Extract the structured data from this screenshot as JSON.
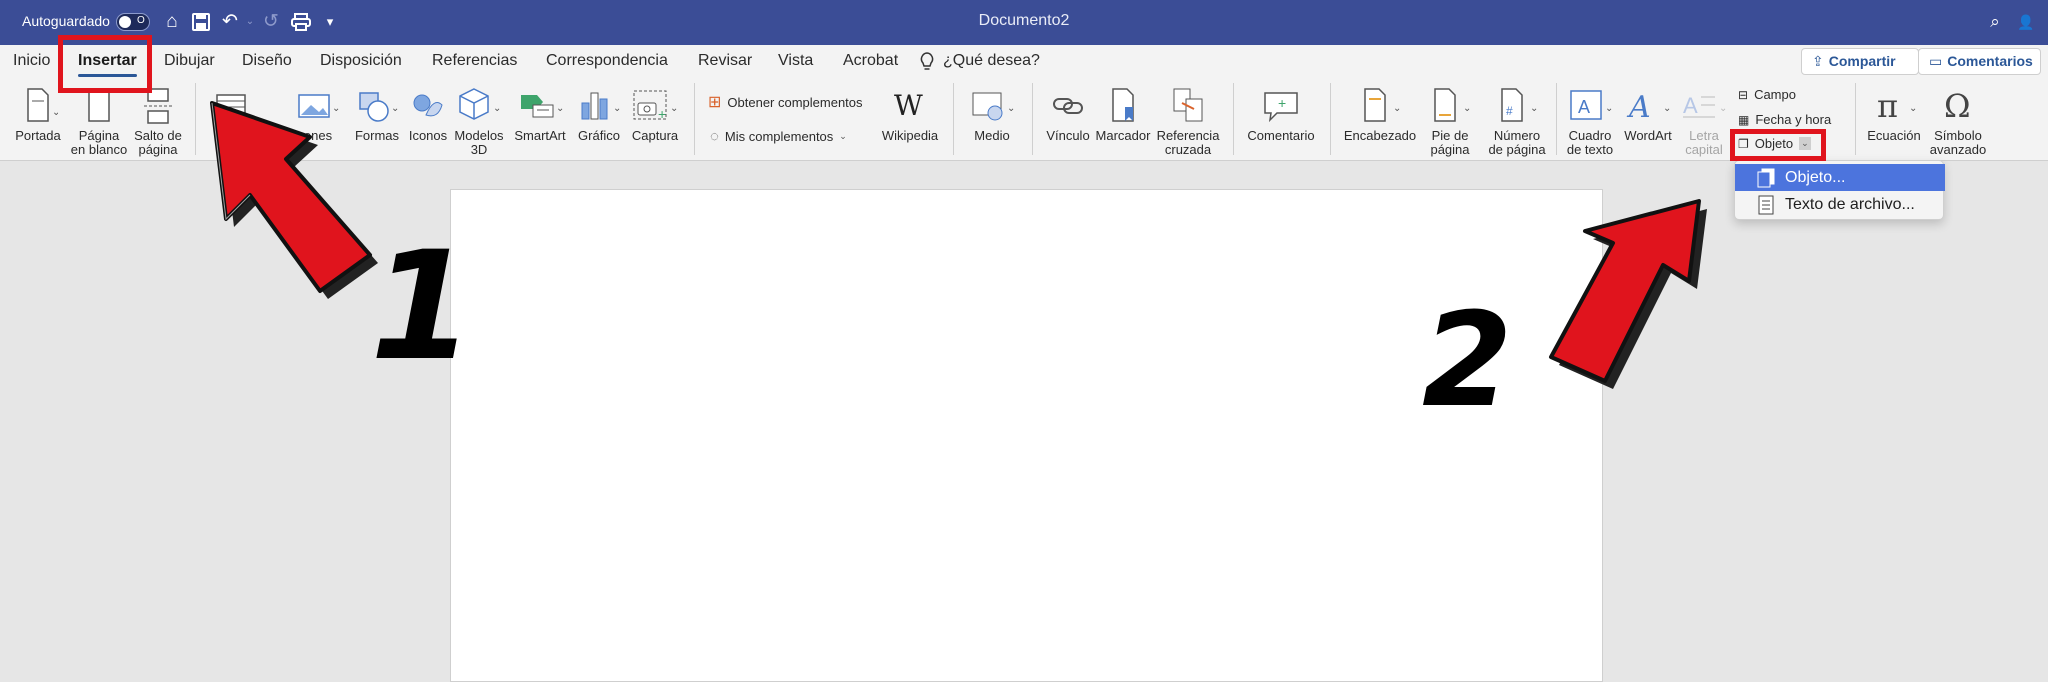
{
  "titlebar": {
    "autosave_label": "Autoguardado",
    "autosave_state": "O",
    "doc_title": "Documento2"
  },
  "tabs": [
    {
      "label": "Inicio"
    },
    {
      "label": "Insertar"
    },
    {
      "label": "Dibujar"
    },
    {
      "label": "Diseño"
    },
    {
      "label": "Disposición"
    },
    {
      "label": "Referencias"
    },
    {
      "label": "Correspondencia"
    },
    {
      "label": "Revisar"
    },
    {
      "label": "Vista"
    },
    {
      "label": "Acrobat"
    }
  ],
  "tell_me": "¿Qué desea?",
  "share_label": "Compartir",
  "comments_label": "Comentarios",
  "ribbon": {
    "portada": "Portada",
    "pagina_blanco_1": "Página",
    "pagina_blanco_2": "en blanco",
    "salto_1": "Salto de",
    "salto_2": "página",
    "imagenes": "enes",
    "formas": "Formas",
    "iconos": "Iconos",
    "modelos_1": "Modelos",
    "modelos_2": "3D",
    "smartart": "SmartArt",
    "grafico": "Gráfico",
    "captura": "Captura",
    "obtener": "Obtener complementos",
    "mis": "Mis complementos",
    "wikipedia": "Wikipedia",
    "medio": "Medio",
    "vinculo": "Vínculo",
    "marcador": "Marcador",
    "ref_1": "Referencia",
    "ref_2": "cruzada",
    "comentario": "Comentario",
    "encabezado": "Encabezado",
    "pie_1": "Pie de",
    "pie_2": "página",
    "num_1": "Número",
    "num_2": "de página",
    "cuadro_1": "Cuadro",
    "cuadro_2": "de texto",
    "wordart": "WordArt",
    "letra_1": "Letra",
    "letra_2": "capital",
    "campo": "Campo",
    "fecha": "Fecha y hora",
    "objeto": "Objeto",
    "ecuacion": "Ecuación",
    "simbolo_1": "Símbolo",
    "simbolo_2": "avanzado"
  },
  "dropdown": {
    "item1": "Objeto...",
    "item2": "Texto de archivo..."
  },
  "annotations": {
    "num1": "1",
    "num2": "2"
  },
  "colors": {
    "titlebar": "#3b4d96",
    "highlight_red": "#e0141d",
    "selection_blue": "#4c74dd"
  }
}
